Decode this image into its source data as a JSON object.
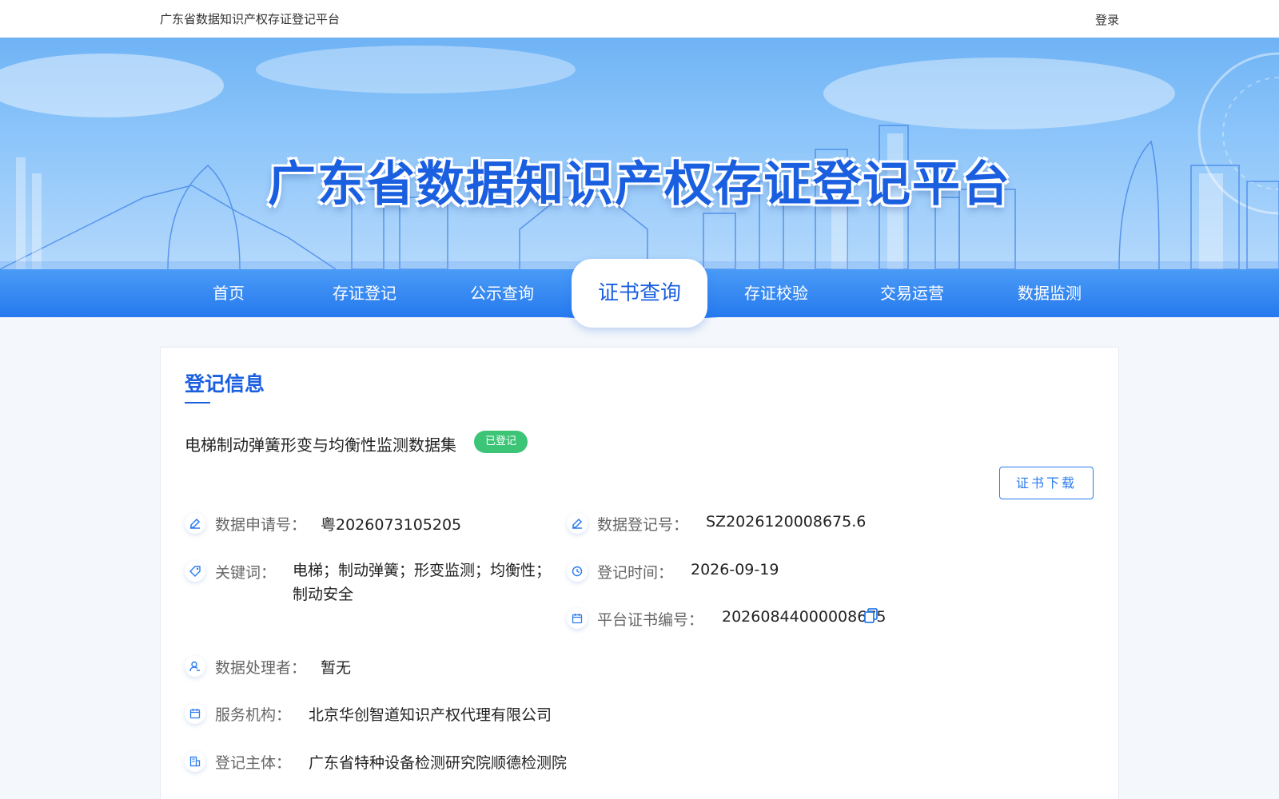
{
  "topbar": {
    "site_name": "广东省数据知识产权存证登记平台",
    "login_label": "登录"
  },
  "banner": {
    "title": "广东省数据知识产权存证登记平台"
  },
  "nav": {
    "items": [
      "首页",
      "存证登记",
      "公示查询",
      "证书查询",
      "存证校验",
      "交易运营",
      "数据监测"
    ],
    "active_index": 3
  },
  "card": {
    "heading": "登记信息",
    "dataset_name": "电梯制动弹簧形变与均衡性监测数据集",
    "status_badge": "已登记",
    "download_label": "证书下载",
    "fields": {
      "application_no": {
        "label": "数据申请号：",
        "value": "粤2026073105205"
      },
      "registration_no": {
        "label": "数据登记号：",
        "value": "SZ2026120008675.6"
      },
      "keywords": {
        "label": "关键词：",
        "value": "电梯；制动弹簧；形变监测；均衡性；制动安全"
      },
      "registration_time": {
        "label": "登记时间：",
        "value": "2026-09-19"
      },
      "certificate_no": {
        "label": "平台证书编号：",
        "value": "20260844000008675"
      },
      "processor": {
        "label": "数据处理者：",
        "value": "暂无"
      },
      "service_agency": {
        "label": "服务机构：",
        "value": "北京华创智道知识产权代理有限公司"
      },
      "registrant": {
        "label": "登记主体：",
        "value": "广东省特种设备检测研究院顺德检测院"
      }
    }
  },
  "colors": {
    "primary": "#1a5fe0",
    "nav_bg": "#2679ee",
    "badge": "#3cc477"
  }
}
